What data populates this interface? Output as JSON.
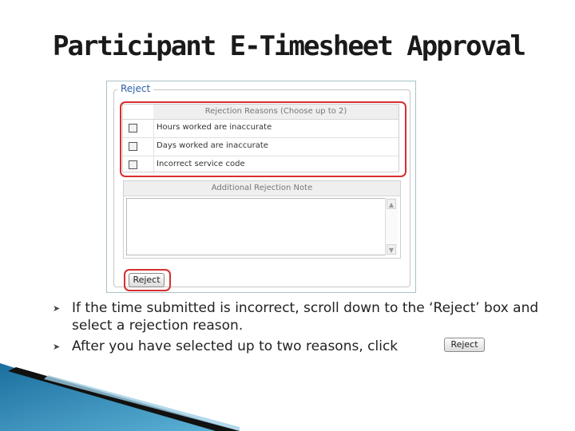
{
  "slide": {
    "title": "Participant E-Timesheet Approval"
  },
  "reject_panel": {
    "legend": "Reject",
    "reasons_header": "Rejection Reasons (Choose up to 2)",
    "reasons": [
      {
        "label": "Hours worked are inaccurate",
        "checked": false
      },
      {
        "label": "Days worked are inaccurate",
        "checked": false
      },
      {
        "label": "Incorrect service code",
        "checked": false
      }
    ],
    "note_header": "Additional Rejection Note",
    "note_value": "",
    "reject_button_label": "Reject"
  },
  "bullets": [
    {
      "text": "If the time submitted is incorrect, scroll down to the ‘Reject’ box and select a rejection reason."
    },
    {
      "text": "After you have selected up to two reasons, click"
    }
  ],
  "inline_button_label": "Reject",
  "colors": {
    "highlight": "#d62f2f",
    "legend": "#2b5fa5",
    "border": "#a9c3c7",
    "deco_blue": "#1b6f9e",
    "deco_dark": "#111111"
  },
  "icons": {
    "bullet": "arrow-bullet-icon",
    "scroll_up": "scroll-up-arrow-icon",
    "scroll_down": "scroll-down-arrow-icon"
  }
}
